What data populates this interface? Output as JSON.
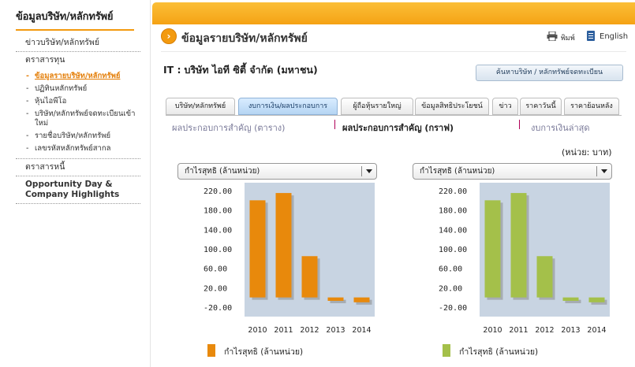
{
  "sidebar": {
    "title": "ข้อมูลบริษัท/หลักทรัพย์",
    "items": [
      {
        "label": "ข่าวบริษัท/หลักทรัพย์"
      },
      {
        "label": "ตราสารทุน"
      }
    ],
    "subitems": [
      {
        "label": "ข้อมูลรายบริษัท/หลักทรัพย์",
        "active": true
      },
      {
        "label": "ปฏิทินหลักทรัพย์"
      },
      {
        "label": "หุ้นไอพีโอ"
      },
      {
        "label": "บริษัท/หลักทรัพย์จดทะเบียนเข้าใหม่"
      },
      {
        "label": "รายชื่อบริษัท/หลักทรัพย์"
      },
      {
        "label": "เลขรหัสหลักทรัพย์สากล"
      }
    ],
    "item_bond": "ตราสารหนี้",
    "item_opportunity": "Opportunity Day & Company Highlights"
  },
  "header": {
    "title": "ข้อมูลรายบริษัท/หลักทรัพย์",
    "print_label": "พิมพ์",
    "lang_label": "English",
    "company_symbol": "IT :",
    "company_name": "บริษัท ไอที ซิตี้ จำกัด (มหาชน)",
    "search_button": "ค้นหาบริษัท / หลักทรัพย์จดทะเบียน"
  },
  "tabs": [
    {
      "label": "บริษัท/หลักทรัพย์"
    },
    {
      "label": "งบการเงิน/ผลประกอบการ",
      "active": true
    },
    {
      "label": "ผู้ถือหุ้นรายใหญ่"
    },
    {
      "label": "ข้อมูลสิทธิประโยชน์"
    },
    {
      "label": "ข่าว"
    },
    {
      "label": "ราคาวันนี้"
    },
    {
      "label": "ราคาย้อนหลัง"
    }
  ],
  "subnav": {
    "table_link": "ผลประกอบการสำคัญ (ตาราง)",
    "graph_link": "ผลประกอบการสำคัญ (กราฟ)",
    "latest_link": "งบการเงินล่าสุด"
  },
  "unit_label": "(หน่วย: บาท)",
  "colors": {
    "accent": "#f5a214",
    "bar_orange": "#e8890c",
    "bar_green": "#a4c04a",
    "plot_bg": "#c8d4e2"
  },
  "charts": [
    {
      "dropdown_value": "กำไรสุทธิ (ล้านหน่วย)",
      "legend": "กำไรสุทธิ (ล้านหน่วย)",
      "color": "#e8890c"
    },
    {
      "dropdown_value": "กำไรสุทธิ (ล้านหน่วย)",
      "legend": "กำไรสุทธิ (ล้านหน่วย)",
      "color": "#a4c04a"
    }
  ],
  "chart_data": [
    {
      "type": "bar",
      "categories": [
        "2010",
        "2011",
        "2012",
        "2013",
        "2014"
      ],
      "values": [
        200,
        215,
        85,
        -7,
        -10
      ],
      "yticks": [
        "220.00",
        "180.00",
        "140.00",
        "100.00",
        "60.00",
        "20.00",
        "-20.00"
      ],
      "ylim": [
        -20,
        220
      ],
      "series": [
        {
          "name": "กำไรสุทธิ (ล้านหน่วย)",
          "values": [
            200,
            215,
            85,
            -7,
            -10
          ]
        }
      ]
    },
    {
      "type": "bar",
      "categories": [
        "2010",
        "2011",
        "2012",
        "2013",
        "2014"
      ],
      "values": [
        200,
        215,
        85,
        -7,
        -10
      ],
      "yticks": [
        "220.00",
        "180.00",
        "140.00",
        "100.00",
        "60.00",
        "20.00",
        "-20.00"
      ],
      "ylim": [
        -20,
        220
      ],
      "series": [
        {
          "name": "กำไรสุทธิ (ล้านหน่วย)",
          "values": [
            200,
            215,
            85,
            -7,
            -10
          ]
        }
      ]
    }
  ]
}
